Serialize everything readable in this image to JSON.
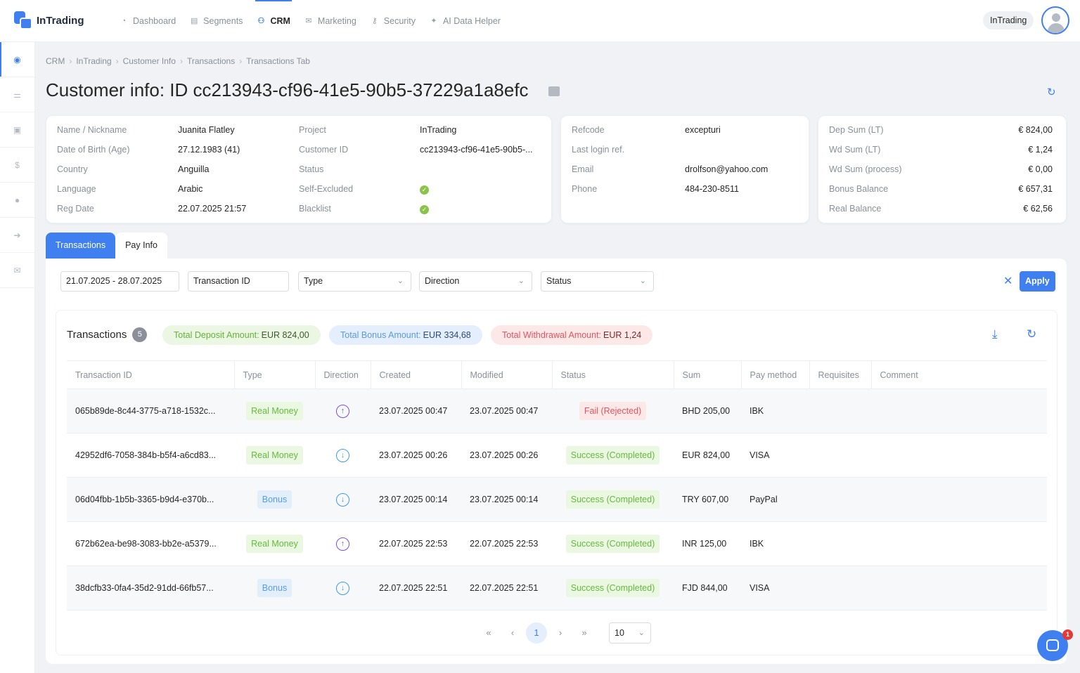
{
  "app": {
    "name": "InTrading"
  },
  "nav": [
    {
      "label": "Dashboard",
      "icon": "dashboard-icon",
      "active": false
    },
    {
      "label": "Segments",
      "icon": "segments-icon",
      "active": false
    },
    {
      "label": "CRM",
      "icon": "users-icon",
      "active": true
    },
    {
      "label": "Marketing",
      "icon": "mail-icon",
      "active": false
    },
    {
      "label": "Security",
      "icon": "key-icon",
      "active": false
    },
    {
      "label": "AI Data Helper",
      "icon": "sparkle-icon",
      "active": false
    }
  ],
  "org_pill": "InTrading",
  "sidebar": [
    "history-icon",
    "sliders-icon",
    "contacts-icon",
    "dollar-icon",
    "user-icon",
    "login-icon",
    "mail-icon"
  ],
  "breadcrumb": [
    "CRM",
    "InTrading",
    "Customer Info",
    "Transactions",
    "Transactions Tab"
  ],
  "title": "Customer info: ID cc213943-cf96-41e5-90b5-37229a1a8efc",
  "info": {
    "left": [
      {
        "k": "Name / Nickname",
        "v": "Juanita Flatley"
      },
      {
        "k": "Date of Birth (Age)",
        "v": "27.12.1983 (41)"
      },
      {
        "k": "Country",
        "v": "Anguilla"
      },
      {
        "k": "Language",
        "v": "Arabic"
      },
      {
        "k": "Reg Date",
        "v": "22.07.2025 21:57"
      }
    ],
    "mid": [
      {
        "k": "Project",
        "v": "InTrading"
      },
      {
        "k": "Customer ID",
        "v": "cc213943-cf96-41e5-90b5-..."
      },
      {
        "k": "Status",
        "v": ""
      },
      {
        "k": "Self-Excluded",
        "v": "✓"
      },
      {
        "k": "Blacklist",
        "v": "✓"
      }
    ],
    "contact": [
      {
        "k": "Refcode",
        "v": "excepturi"
      },
      {
        "k": "Last login ref.",
        "v": ""
      },
      {
        "k": "Email",
        "v": "drolfson@yahoo.com"
      },
      {
        "k": "Phone",
        "v": "484-230-8511"
      }
    ],
    "balance": [
      {
        "k": "Dep Sum (LT)",
        "v": "€ 824,00"
      },
      {
        "k": "Wd Sum (LT)",
        "v": "€ 1,24"
      },
      {
        "k": "Wd Sum (process)",
        "v": "€ 0,00"
      },
      {
        "k": "Bonus Balance",
        "v": "€ 657,31"
      },
      {
        "k": "Real Balance",
        "v": "€ 62,56"
      }
    ]
  },
  "tabs": [
    "Transactions",
    "Pay Info"
  ],
  "filters": {
    "date": "21.07.2025 - 28.07.2025",
    "txid_placeholder": "Transaction ID",
    "type": "Type",
    "direction": "Direction",
    "status": "Status",
    "apply": "Apply"
  },
  "transactions": {
    "title": "Transactions",
    "count": "5",
    "totals": {
      "deposit_label": "Total Deposit Amount:",
      "deposit_value": "EUR 824,00",
      "bonus_label": "Total Bonus Amount:",
      "bonus_value": "EUR 334,68",
      "withdrawal_label": "Total Withdrawal Amount:",
      "withdrawal_value": "EUR 1,24"
    },
    "columns": [
      "Transaction ID",
      "Type",
      "Direction",
      "Created",
      "Modified",
      "Status",
      "Sum",
      "Pay method",
      "Requisites",
      "Comment"
    ],
    "rows": [
      {
        "id": "065b89de-8c44-3775-a718-1532c...",
        "type": "Real Money",
        "dir": "out",
        "created": "23.07.2025 00:47",
        "modified": "23.07.2025 00:47",
        "status": "Fail (Rejected)",
        "sum": "BHD 205,00",
        "method": "IBK"
      },
      {
        "id": "42952df6-7058-384b-b5f4-a6cd83...",
        "type": "Real Money",
        "dir": "in",
        "created": "23.07.2025 00:26",
        "modified": "23.07.2025 00:26",
        "status": "Success (Completed)",
        "sum": "EUR 824,00",
        "method": "VISA"
      },
      {
        "id": "06d04fbb-1b5b-3365-b9d4-e370b...",
        "type": "Bonus",
        "dir": "in",
        "created": "23.07.2025 00:14",
        "modified": "23.07.2025 00:14",
        "status": "Success (Completed)",
        "sum": "TRY 607,00",
        "method": "PayPal"
      },
      {
        "id": "672b62ea-be98-3083-bb2e-a5379...",
        "type": "Real Money",
        "dir": "out",
        "created": "22.07.2025 22:53",
        "modified": "22.07.2025 22:53",
        "status": "Success (Completed)",
        "sum": "INR 125,00",
        "method": "IBK"
      },
      {
        "id": "38dcfb33-0fa4-35d2-91dd-66fb57...",
        "type": "Bonus",
        "dir": "in",
        "created": "22.07.2025 22:51",
        "modified": "22.07.2025 22:51",
        "status": "Success (Completed)",
        "sum": "FJD 844,00",
        "method": "VISA"
      }
    ]
  },
  "pagination": {
    "current": "1",
    "page_size": "10"
  },
  "chat": {
    "badge": "1"
  }
}
